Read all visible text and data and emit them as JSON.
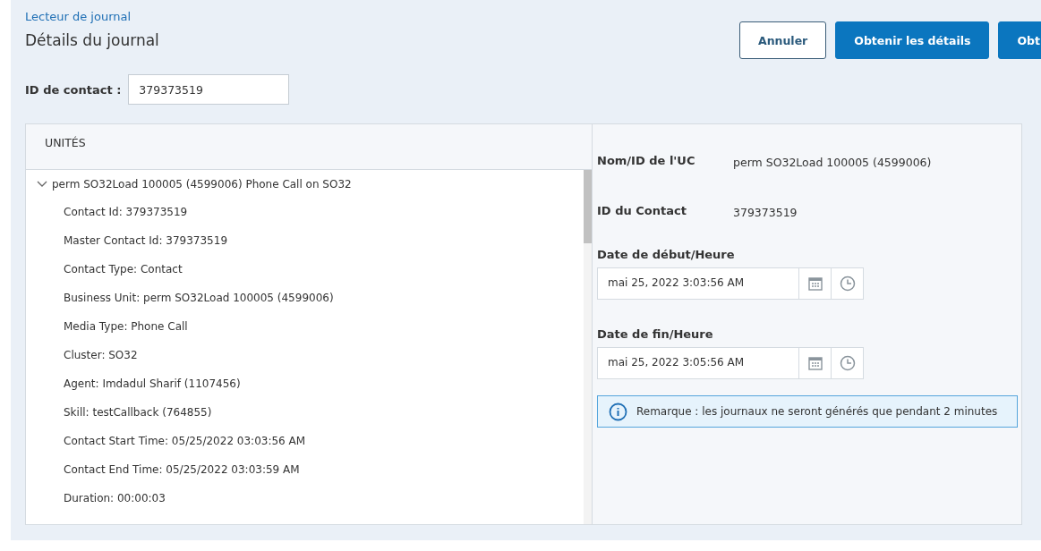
{
  "breadcrumb": "Lecteur de journal",
  "title": "Détails du journal",
  "buttons": [
    {
      "label": "Annuler",
      "kind": "secondary"
    },
    {
      "label": "Obtenir les détails",
      "kind": "primary"
    },
    {
      "label": "Obt",
      "kind": "primary"
    }
  ],
  "contact_field": {
    "label": "ID de contact :",
    "value": "379373519"
  },
  "units": {
    "heading": "UNITÉS",
    "tree": [
      {
        "label": "perm SO32Load 100005 (4599006) Phone Call on SO32",
        "expanded": true,
        "children": [
          {
            "label": "Contact Id: 379373519"
          },
          {
            "label": "Master Contact Id: 379373519"
          },
          {
            "label": "Contact Type: Contact"
          },
          {
            "label": "Business Unit: perm SO32Load 100005 (4599006)"
          },
          {
            "label": "Media Type: Phone Call"
          },
          {
            "label": "Cluster: SO32"
          },
          {
            "label": "Agent: Imdadul Sharif (1107456)"
          },
          {
            "label": "Skill: testCallback (764855)"
          },
          {
            "label": "Contact Start Time: 05/25/2022 03:03:56 AM"
          },
          {
            "label": "Contact End Time: 05/25/2022 03:03:59 AM"
          },
          {
            "label": "Duration: 00:00:03"
          }
        ]
      }
    ]
  },
  "details": [
    {
      "label": "Nom/ID de l'UC",
      "value": "perm SO32Load 100005 (4599006)"
    },
    {
      "label": "ID du Contact",
      "value": "379373519"
    }
  ],
  "date_fields": [
    {
      "label": "Date de début/Heure",
      "value": "mai 25, 2022 3:03:56 AM"
    },
    {
      "label": "Date de fin/Heure",
      "value": "mai 25, 2022 3:05:56 AM"
    }
  ],
  "note": "Remarque : les journaux ne seront générés que pendant 2 minutes"
}
